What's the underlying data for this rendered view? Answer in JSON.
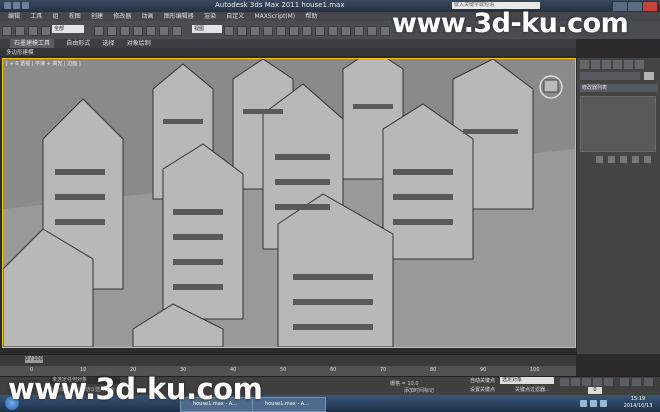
{
  "window": {
    "title": "Autodesk 3ds Max  2011    house1.max",
    "search_placeholder": "键入关键字或短语"
  },
  "watermarks": {
    "top": "www.3d-ku.com",
    "bottom": "www.3d-ku.com"
  },
  "menu": {
    "items": [
      "编辑",
      "工具",
      "组",
      "视图",
      "创建",
      "修改器",
      "动画",
      "图形编辑器",
      "渲染",
      "自定义",
      "MAXScript(M)",
      "帮助"
    ]
  },
  "toolbar": {
    "selection_filter": "全部",
    "reference_coord": "视图"
  },
  "ribbon": {
    "tabs": [
      "石墨建模工具",
      "自由形式",
      "选择",
      "对象绘制"
    ],
    "active_tab": "石墨建模工具",
    "sub_label": "多边形建模"
  },
  "viewport": {
    "label": "[ + 0 透视 | 平滑 + 高光 | 边面 ]"
  },
  "command_panel": {
    "dropdown": "修改器列表"
  },
  "timeline": {
    "slider_label": "0 / 100",
    "ticks": [
      "0",
      "10",
      "20",
      "30",
      "40",
      "50",
      "60",
      "70",
      "80",
      "90",
      "100"
    ]
  },
  "status": {
    "objects": "未选定任何对象",
    "message": "单击或单击并拖动以选择对象",
    "coords": "栅格 = 10.0",
    "auto_key": "自动关键点",
    "set_key": "设置关键点",
    "selection_set": "选定对象",
    "key_filter": "关键点过滤器...",
    "add_time_tag": "添加时间标记",
    "frame": "0"
  },
  "taskbar": {
    "tasks": [
      "house1.max - A...",
      "house1.max - A..."
    ],
    "clock_time": "15:19",
    "clock_date": "2014/10/13"
  }
}
